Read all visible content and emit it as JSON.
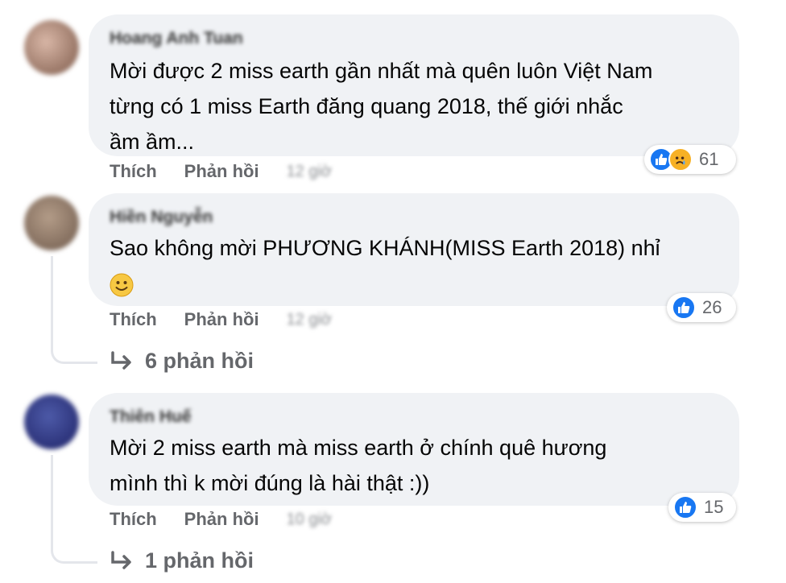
{
  "comments": [
    {
      "author": "Hoang Anh Tuan",
      "text_lines": [
        "Mời được 2 miss earth gần nhất mà quên luôn Việt Nam",
        "từng có 1 miss Earth đăng quang 2018, thế giới nhắc",
        "ầm ầm..."
      ],
      "like_label": "Thích",
      "reply_label": "Phản hồi",
      "time": "12 giờ",
      "reactions": [
        "like-icon",
        "sad-icon"
      ],
      "reaction_count": "61"
    },
    {
      "author": "Hiền Nguyễn",
      "text_lines": [
        "Sao không mời PHƯƠNG KHÁNH(MISS Earth 2018) nhỉ"
      ],
      "emoji": "slightly-smiling-face-icon",
      "like_label": "Thích",
      "reply_label": "Phản hồi",
      "time": "12 giờ",
      "reactions": [
        "like-icon"
      ],
      "reaction_count": "26",
      "replies_label": "6 phản hồi"
    },
    {
      "author": "Thiên Huế",
      "text_lines": [
        "Mời 2 miss earth mà miss earth ở chính quê hương",
        "mình thì k mời đúng là hài thật :))"
      ],
      "like_label": "Thích",
      "reply_label": "Phản hồi",
      "time": "10 giờ",
      "reactions": [
        "like-icon"
      ],
      "reaction_count": "15",
      "replies_label": "1 phản hồi"
    }
  ],
  "colors": {
    "bubble": "#f0f2f5",
    "like_blue": "#1877f2",
    "secondary_text": "#65676b"
  }
}
